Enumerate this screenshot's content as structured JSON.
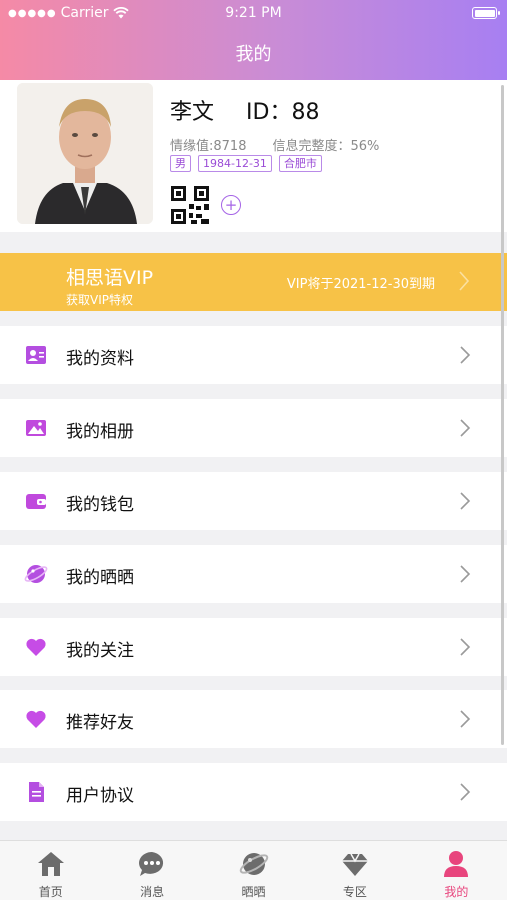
{
  "status_bar": {
    "carrier": "Carrier",
    "time": "9:21 PM"
  },
  "header": {
    "title": "我的"
  },
  "profile": {
    "name": "李文",
    "id_label": "ID：88",
    "affinity": "情缘值:8718",
    "completeness": "信息完整度：56%",
    "tags": [
      "男",
      "1984-12-31",
      "合肥市"
    ]
  },
  "vip": {
    "title": "相思语VIP",
    "subtitle": "获取VIP特权",
    "expiry": "VIP将于2021-12-30到期"
  },
  "menu": [
    {
      "label": "我的资料",
      "icon": "profile-card-icon"
    },
    {
      "label": "我的相册",
      "icon": "album-icon"
    },
    {
      "label": "我的钱包",
      "icon": "wallet-icon"
    },
    {
      "label": "我的晒晒",
      "icon": "planet-icon"
    },
    {
      "label": "我的关注",
      "icon": "heart-icon"
    },
    {
      "label": "推荐好友",
      "icon": "heart-icon"
    },
    {
      "label": "用户协议",
      "icon": "document-icon"
    }
  ],
  "tabbar": [
    {
      "label": "首页",
      "icon": "home-icon"
    },
    {
      "label": "消息",
      "icon": "chat-icon"
    },
    {
      "label": "晒晒",
      "icon": "planet-icon"
    },
    {
      "label": "专区",
      "icon": "diamond-icon"
    },
    {
      "label": "我的",
      "icon": "user-icon",
      "active": true
    }
  ],
  "colors": {
    "accent": "#e8457d",
    "vip": "#f7c247",
    "header_start": "#f58aa6",
    "header_end": "#a77ff2",
    "icon_purple": "#b44ee0"
  }
}
